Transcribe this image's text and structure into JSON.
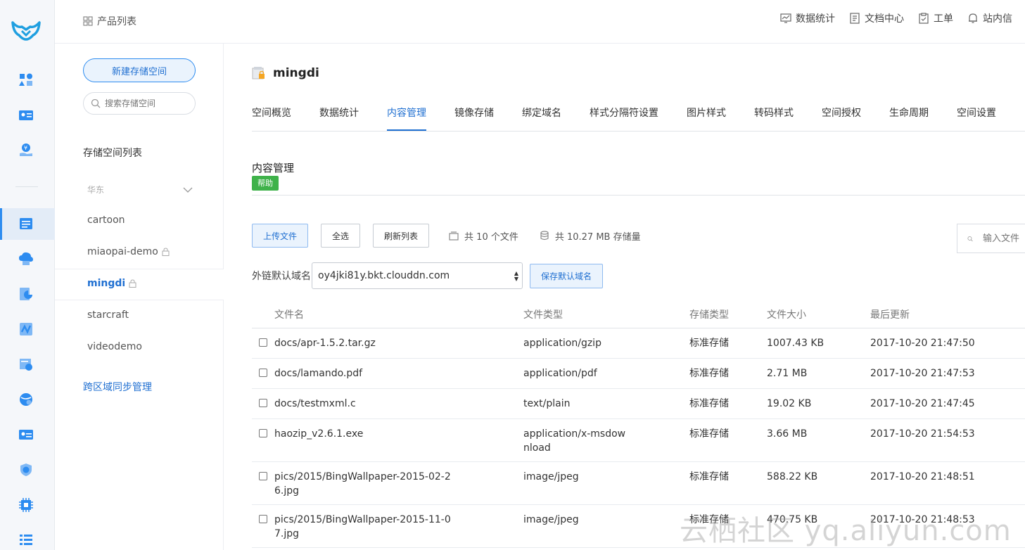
{
  "breadcrumb": {
    "label": "产品列表"
  },
  "topnav": [
    {
      "label": "数据统计",
      "icon": "chart-icon"
    },
    {
      "label": "文档中心",
      "icon": "document-icon"
    },
    {
      "label": "工单",
      "icon": "clipboard-icon"
    },
    {
      "label": "站内信",
      "icon": "bell-icon"
    }
  ],
  "sidebar": {
    "new_button": "新建存储空间",
    "search_placeholder": "搜索存储空间",
    "list_title": "存储空间列表",
    "region": "华东",
    "buckets": [
      {
        "name": "cartoon",
        "locked": false
      },
      {
        "name": "miaopai-demo",
        "locked": true
      },
      {
        "name": "mingdi",
        "locked": true,
        "active": true
      },
      {
        "name": "starcraft",
        "locked": false
      },
      {
        "name": "videodemo",
        "locked": false
      }
    ],
    "cross_region_link": "跨区域同步管理"
  },
  "bucket": {
    "name": "mingdi"
  },
  "tabs": [
    "空间概览",
    "数据统计",
    "内容管理",
    "镜像存储",
    "绑定域名",
    "样式分隔符设置",
    "图片样式",
    "转码样式",
    "空间授权",
    "生命周期",
    "空间设置"
  ],
  "active_tab": "内容管理",
  "section": {
    "title": "内容管理",
    "help_badge": "帮助"
  },
  "toolbar": {
    "upload": "上传文件",
    "select_all": "全选",
    "refresh": "刷新列表",
    "file_count": "共 10 个文件",
    "storage": "共 10.27 MB 存储量",
    "search_placeholder": "输入文件"
  },
  "domain": {
    "label": "外链默认域名",
    "value": "oy4jki81y.bkt.clouddn.com",
    "save": "保存默认域名"
  },
  "table": {
    "headers": [
      "文件名",
      "文件类型",
      "存储类型",
      "文件大小",
      "最后更新"
    ],
    "rows": [
      {
        "name": "docs/apr-1.5.2.tar.gz",
        "type": "application/gzip",
        "storage": "标准存储",
        "size": "1007.43 KB",
        "time": "2017-10-20 21:47:50"
      },
      {
        "name": "docs/lamando.pdf",
        "type": "application/pdf",
        "storage": "标准存储",
        "size": "2.71 MB",
        "time": "2017-10-20 21:47:53"
      },
      {
        "name": "docs/testmxml.c",
        "type": "text/plain",
        "storage": "标准存储",
        "size": "19.02 KB",
        "time": "2017-10-20 21:47:45"
      },
      {
        "name": "haozip_v2.6.1.exe",
        "type": "application/x-msdownload",
        "storage": "标准存储",
        "size": "3.66 MB",
        "time": "2017-10-20 21:54:53"
      },
      {
        "name": "pics/2015/BingWallpaper-2015-02-26.jpg",
        "type": "image/jpeg",
        "storage": "标准存储",
        "size": "588.22 KB",
        "time": "2017-10-20 21:48:51"
      },
      {
        "name": "pics/2015/BingWallpaper-2015-11-07.jpg",
        "type": "image/jpeg",
        "storage": "标准存储",
        "size": "470.75 KB",
        "time": "2017-10-20 21:48:53"
      }
    ]
  },
  "watermark": "云栖社区 yq.aliyun.com",
  "colors": {
    "accent": "#1f6fd1",
    "help_green": "#3fb24a",
    "active_rail": "#e3ecf7"
  }
}
